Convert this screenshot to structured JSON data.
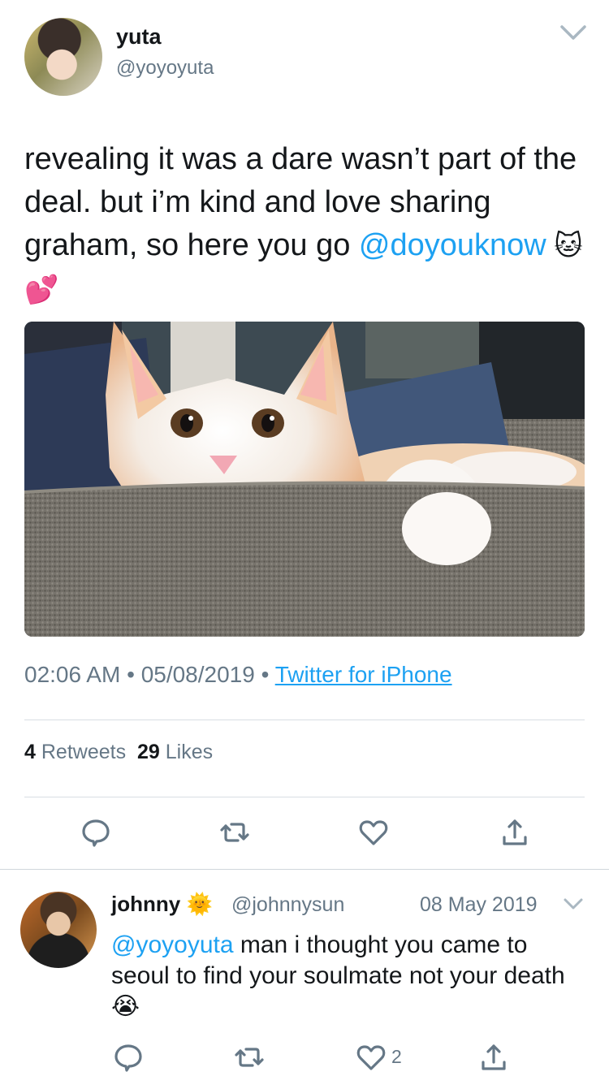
{
  "tweet": {
    "author": {
      "name": "yuta",
      "handle": "@yoyoyuta"
    },
    "text_before": "revealing it was a dare wasn’t part of the deal. but i’m kind and love sharing graham, so here you go ",
    "mention": "@doyouknow",
    "emojis": " 🐱 💕",
    "time": "02:06 AM",
    "separator": "•",
    "date": "05/08/2019",
    "source": "Twitter for iPhone",
    "retweets_count": "4",
    "retweets_label": "Retweets",
    "likes_count": "29",
    "likes_label": "Likes",
    "actions": [
      "reply-icon",
      "retweet-icon",
      "like-icon",
      "share-icon"
    ]
  },
  "reply": {
    "author": {
      "name": "johnny",
      "badge": "🌞",
      "handle": "@johnnysun"
    },
    "date": "08 May 2019",
    "mention": "@yoyoyuta",
    "text": " man i thought you came to seoul to find your soulmate not your death ",
    "emoji": "😭",
    "like_count": "2"
  },
  "colors": {
    "link": "#1da1f2",
    "secondary_text": "#657786",
    "primary_text": "#14171a",
    "divider": "#d8dee3"
  }
}
